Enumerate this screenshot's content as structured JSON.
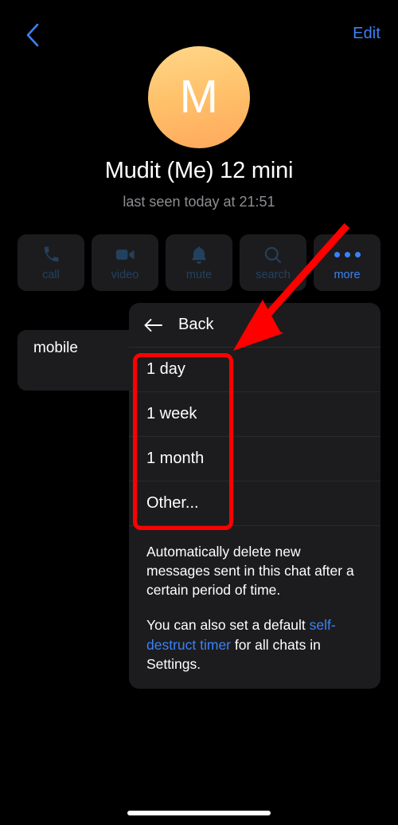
{
  "navbar": {
    "back_icon": "chevron-left-icon",
    "edit_label": "Edit"
  },
  "profile": {
    "avatar_letter": "M",
    "avatar_gradient_from": "#ffd78a",
    "avatar_gradient_to": "#ffa85c",
    "name": "Mudit (Me) 12 mini",
    "status": "last seen today at 21:51"
  },
  "actions": [
    {
      "label": "call",
      "icon": "phone-icon",
      "dimmed": true
    },
    {
      "label": "video",
      "icon": "video-camera-icon",
      "dimmed": true
    },
    {
      "label": "mute",
      "icon": "bell-icon",
      "dimmed": true
    },
    {
      "label": "search",
      "icon": "magnifier-icon",
      "dimmed": true
    },
    {
      "label": "more",
      "icon": "ellipsis-icon",
      "dimmed": false
    }
  ],
  "info_card": {
    "value": "mobile",
    "sub": ""
  },
  "popup": {
    "header": {
      "back_icon": "arrow-left-icon",
      "title": "Back"
    },
    "options": [
      {
        "label": "1 day"
      },
      {
        "label": "1 week"
      },
      {
        "label": "1 month"
      },
      {
        "label": "Other..."
      }
    ],
    "description": {
      "paragraph_1": "Automatically delete new messages sent in this chat after a certain period of time.",
      "paragraph_2_pre": "You can also set a default ",
      "paragraph_2_link": "self-destruct timer",
      "paragraph_2_post": " for all chats in Settings."
    }
  },
  "annotations": {
    "highlight_color": "#ff0000",
    "arrow_color": "#ff0000"
  },
  "colors": {
    "accent_blue": "#3b82f6",
    "background": "#000000",
    "card": "#1c1c1e",
    "secondary_text": "#8e8e93"
  }
}
